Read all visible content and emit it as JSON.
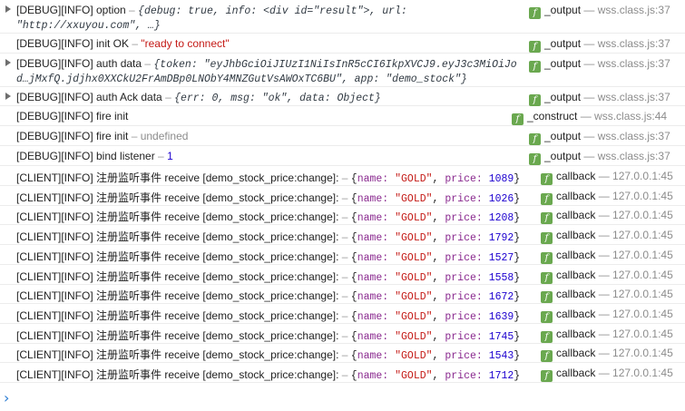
{
  "rows": [
    {
      "text": "[DEBUG][INFO] option",
      "sep": " – ",
      "obj": "{debug: true, info: <div id=\"result\">, url: \"http://xxuyou.com\", …}",
      "func": "_output",
      "file": "wss.class.js:37"
    },
    {
      "text": "[DEBUG][INFO] init OK",
      "sep": " – ",
      "value": "\"ready to connect\"",
      "func": "_output",
      "file": "wss.class.js:37"
    },
    {
      "text": "[DEBUG][INFO] auth data",
      "sep": " – ",
      "obj": "{token: \"eyJhbGciOiJIUzI1NiIsInR5cCI6IkpXVCJ9.eyJ3c3MiOiJod…jMxfQ.jdjhx0XXCkU2FrAmDBp0LNObY4MNZGutVsAWOxTC6BU\", app: \"demo_stock\"}",
      "func": "_output",
      "file": "wss.class.js:37"
    },
    {
      "text": "[DEBUG][INFO] auth Ack data",
      "sep": " – ",
      "obj": "{err: 0, msg: \"ok\", data: Object}",
      "func": "_output",
      "file": "wss.class.js:37"
    },
    {
      "text": "[DEBUG][INFO] fire init",
      "func": "_construct",
      "file": "wss.class.js:44"
    },
    {
      "text": "[DEBUG][INFO] fire init",
      "sep": " – ",
      "value": "undefined",
      "func": "_output",
      "file": "wss.class.js:37"
    },
    {
      "text": "[DEBUG][INFO] bind listener",
      "sep": " – ",
      "value": "1",
      "func": "_output",
      "file": "wss.class.js:37"
    }
  ],
  "client_rows": {
    "text": "[CLIENT][INFO] 注册监听事件 receive [demo_stock_price:change]:",
    "sep": " – ",
    "name_key": "name:",
    "name_val": "\"GOLD\"",
    "price_key": "price:",
    "func": "callback",
    "file": "127.0.0.1:45",
    "prices": [
      "1089",
      "1026",
      "1208",
      "1792",
      "1527",
      "1558",
      "1672",
      "1639",
      "1745",
      "1543",
      "1712"
    ]
  },
  "prompt_glyph": "›"
}
